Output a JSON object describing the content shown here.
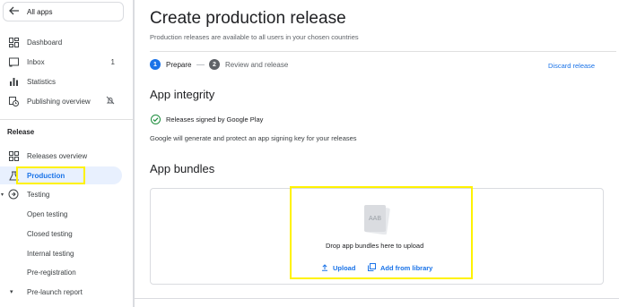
{
  "sidebar": {
    "all_apps_label": "All apps",
    "items": [
      {
        "label": "Dashboard",
        "icon": "dashboard-icon"
      },
      {
        "label": "Inbox",
        "icon": "inbox-icon",
        "count": "1"
      },
      {
        "label": "Statistics",
        "icon": "bar-chart-icon"
      },
      {
        "label": "Publishing overview",
        "icon": "schedule-icon"
      }
    ],
    "release_section": "Release",
    "release_items": [
      {
        "label": "Releases overview",
        "icon": "grid-icon"
      },
      {
        "label": "Production",
        "icon": "flask-icon",
        "active": true
      },
      {
        "label": "Testing",
        "icon": "testing-icon"
      },
      {
        "label": "Open testing"
      },
      {
        "label": "Closed testing"
      },
      {
        "label": "Internal testing"
      },
      {
        "label": "Pre-registration"
      },
      {
        "label": "Pre-launch report"
      }
    ]
  },
  "header": {
    "title": "Create production release",
    "subtitle": "Production releases are available to all users in your chosen countries"
  },
  "steps": [
    {
      "num": "1",
      "label": "Prepare"
    },
    {
      "num": "2",
      "label": "Review and release"
    }
  ],
  "discard_label": "Discard release",
  "integrity": {
    "heading": "App integrity",
    "signed": "Releases signed by Google Play",
    "description": "Google will generate and protect an app signing key for your releases"
  },
  "bundles": {
    "heading": "App bundles",
    "aab_label": "AAB",
    "drop_text": "Drop app bundles here to upload",
    "upload_label": "Upload",
    "library_label": "Add from library"
  },
  "colors": {
    "accent": "#1a73e8",
    "highlight": "#fff200",
    "success": "#1e8e3e"
  }
}
